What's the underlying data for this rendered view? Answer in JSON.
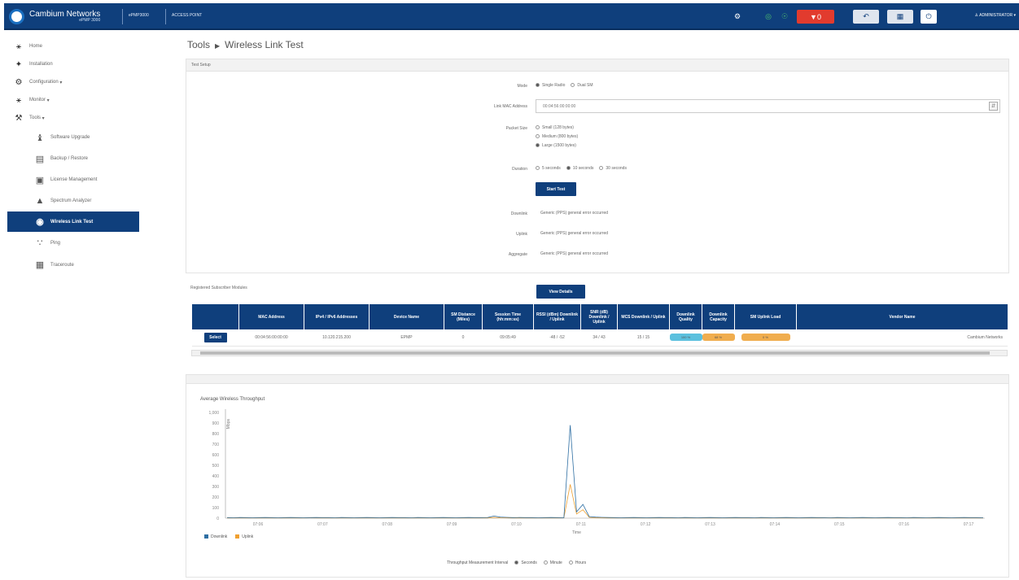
{
  "topbar": {
    "brand_name": "Cambium Networks",
    "brand_sub": "ePMP 3000",
    "mode_label": "ePMP3000",
    "device_label": "ACCESS POINT",
    "badge_count": "0",
    "alert_count": "0",
    "user_label": "ADMINISTRATOR"
  },
  "sidebar": {
    "items": [
      {
        "label": "Home",
        "icon": "home-icon"
      },
      {
        "label": "Installation",
        "icon": "installation-icon"
      },
      {
        "label": "Configuration",
        "icon": "gear-icon"
      },
      {
        "label": "Monitor",
        "icon": "monitor-icon"
      },
      {
        "label": "Tools",
        "icon": "wrench-icon"
      }
    ],
    "subitems": [
      {
        "label": "Software Upgrade",
        "icon": "upgrade-icon"
      },
      {
        "label": "Backup / Restore",
        "icon": "backup-icon"
      },
      {
        "label": "License Management",
        "icon": "license-icon"
      },
      {
        "label": "Spectrum Analyzer",
        "icon": "spectrum-icon"
      },
      {
        "label": "Wireless Link Test",
        "icon": "link-test-icon",
        "active": true
      },
      {
        "label": "Ping",
        "icon": "ping-icon"
      },
      {
        "label": "Traceroute",
        "icon": "traceroute-icon"
      }
    ]
  },
  "page": {
    "breadcrumb_root": "Tools",
    "breadcrumb_current": "Wireless Link Test"
  },
  "test_setup": {
    "heading": "Test Setup",
    "mode_label": "Mode",
    "mode_options": [
      "Single Radio",
      "Dual SM"
    ],
    "mode_selected": "Single Radio",
    "mac_label": "Link MAC Address",
    "mac_value": "00:04:56:00:00:00",
    "packet_label": "Packet Size",
    "packet_options": [
      "Small (128 bytes)",
      "Medium (800 bytes)",
      "Large (1500 bytes)"
    ],
    "packet_selected": "Large (1500 bytes)",
    "duration_label": "Duration",
    "duration_options": [
      "5 seconds",
      "10 seconds",
      "30 seconds"
    ],
    "duration_selected": "10 seconds",
    "start_button": "Start Test",
    "downlink_label": "Downlink",
    "downlink_value": "Generic (PPS) general error occurred",
    "uplink_label": "Uplink",
    "uplink_value": "Generic (PPS) general error occurred",
    "aggregate_label": "Aggregate",
    "aggregate_value": "Generic (PPS) general error occurred"
  },
  "results": {
    "heading": "Registered Subscriber Modules",
    "view_button": "View Details",
    "columns": [
      "",
      "MAC Address",
      "IPv4 / IPv6 Addresses",
      "Device Name",
      "SM Distance (Miles)",
      "Session Time (hh:mm:ss)",
      "RSSI (dBm) Downlink / Uplink",
      "SNR (dB) Downlink / Uplink",
      "MCS Downlink / Uplink",
      "Downlink Quality",
      "Downlink Capacity",
      "SM Uplink Load",
      "Vendor Name"
    ],
    "rows": [
      {
        "select": "Select",
        "mac": "00:04:56:00:00:00",
        "ip": "10.120.215.200",
        "name": "EPMP",
        "distance": "0",
        "session": "09:05:49",
        "rssi": "-48 / -52",
        "snr": "34 / 43",
        "mcs": "15 / 15",
        "quality": "100 %",
        "capacity": "68 %",
        "load": "0 %",
        "vendor": "Cambium Networks"
      }
    ]
  },
  "chart_data": {
    "type": "line",
    "title": "Average Wireless Throughput",
    "ylabel": "Mbps",
    "xlabel": "Time",
    "ylim": [
      0,
      1000
    ],
    "y_ticks": [
      "1,000",
      "900",
      "800",
      "700",
      "600",
      "500",
      "400",
      "300",
      "200",
      "100",
      "0"
    ],
    "x_ticks": [
      "07:06",
      "07:07",
      "07:08",
      "07:09",
      "07:10",
      "07:11",
      "07:12",
      "07:13",
      "07:14",
      "07:15",
      "07:16",
      "07:17"
    ],
    "series": [
      {
        "name": "Downlink",
        "color": "#2f6fa3",
        "values": [
          5,
          4,
          6,
          5,
          4,
          5,
          6,
          5,
          4,
          5,
          6,
          5,
          4,
          5,
          6,
          5,
          5,
          4,
          6,
          5,
          4,
          5,
          6,
          5,
          4,
          5,
          6,
          5,
          5,
          4,
          6,
          5,
          4,
          5,
          6,
          5,
          4,
          5,
          6,
          5,
          5,
          6,
          20,
          10,
          8,
          5,
          6,
          5,
          5,
          4,
          5,
          6,
          5,
          4,
          880,
          60,
          130,
          15,
          10,
          8,
          6,
          5,
          4,
          5,
          6,
          5,
          4,
          5,
          6,
          5,
          5,
          4,
          6,
          5,
          4,
          5,
          6,
          5,
          4,
          5,
          6,
          5,
          5,
          4,
          6,
          5,
          4,
          5,
          6,
          5,
          4,
          5,
          6,
          5,
          5,
          4,
          6,
          5,
          4,
          5,
          6,
          5,
          4,
          5,
          6,
          5,
          5,
          4,
          6,
          5,
          4,
          5,
          6,
          5,
          4,
          5,
          6,
          5,
          5,
          4
        ]
      },
      {
        "name": "Uplink",
        "color": "#f0a030",
        "values": [
          2,
          3,
          2,
          2,
          3,
          2,
          2,
          3,
          2,
          2,
          3,
          2,
          2,
          3,
          2,
          2,
          3,
          2,
          2,
          3,
          2,
          2,
          3,
          2,
          2,
          3,
          2,
          2,
          3,
          2,
          2,
          3,
          2,
          2,
          3,
          2,
          2,
          3,
          2,
          2,
          3,
          2,
          8,
          4,
          3,
          2,
          2,
          3,
          2,
          2,
          3,
          2,
          2,
          3,
          320,
          40,
          80,
          8,
          5,
          3,
          2,
          3,
          2,
          2,
          3,
          2,
          2,
          3,
          2,
          2,
          3,
          2,
          2,
          3,
          2,
          2,
          3,
          2,
          2,
          3,
          2,
          2,
          3,
          2,
          2,
          3,
          2,
          2,
          3,
          2,
          2,
          3,
          2,
          2,
          3,
          2,
          2,
          3,
          2,
          2,
          3,
          2,
          2,
          3,
          2,
          2,
          3,
          2,
          2,
          3,
          2,
          2,
          3,
          2,
          2,
          3,
          2,
          2,
          3,
          2
        ]
      }
    ],
    "legend": "bottom-left"
  },
  "interval": {
    "label": "Throughput Measurement Interval",
    "options": [
      "Seconds",
      "Minute",
      "Hours"
    ],
    "selected": "Seconds"
  }
}
